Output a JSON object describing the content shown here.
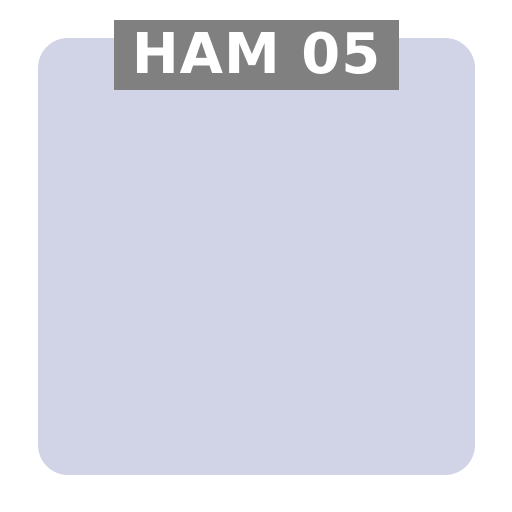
{
  "swatch": {
    "label": "HAM 05",
    "color": "#d1d3e6",
    "label_background": "#808080",
    "label_text_color": "#ffffff"
  }
}
